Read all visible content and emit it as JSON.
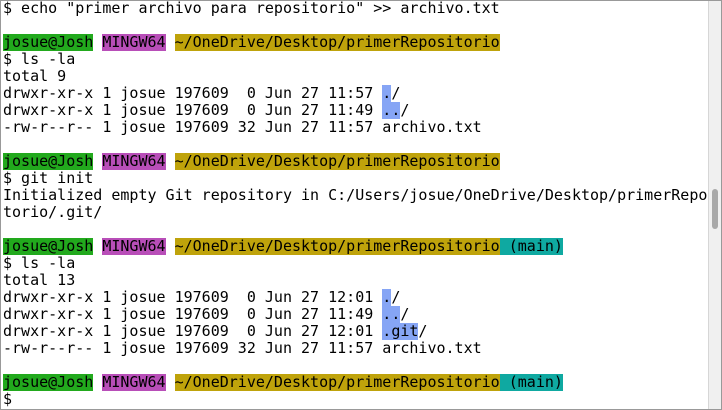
{
  "colors": {
    "user": "#22a91d",
    "system": "#b84eb8",
    "path": "#bfa30b",
    "branch": "#0fa9a1",
    "directory": "#86a5f5"
  },
  "lines": [
    {
      "segments": [
        {
          "text": "$ echo \"primer archivo para repositorio\" >> archivo.txt"
        }
      ]
    },
    {
      "segments": []
    },
    {
      "segments": [
        {
          "text": "josue@Josh",
          "hl": "user"
        },
        {
          "text": " "
        },
        {
          "text": "MINGW64",
          "hl": "system"
        },
        {
          "text": " "
        },
        {
          "text": "~/OneDrive/Desktop/primerRepositorio",
          "hl": "path"
        }
      ]
    },
    {
      "segments": [
        {
          "text": "$ ls -la"
        }
      ]
    },
    {
      "segments": [
        {
          "text": "total 9"
        }
      ]
    },
    {
      "segments": [
        {
          "text": "drwxr-xr-x 1 josue 197609  0 Jun 27 11:57 "
        },
        {
          "text": ".",
          "hl": "directory"
        },
        {
          "text": "/"
        }
      ]
    },
    {
      "segments": [
        {
          "text": "drwxr-xr-x 1 josue 197609  0 Jun 27 11:49 "
        },
        {
          "text": "..",
          "hl": "directory"
        },
        {
          "text": "/"
        }
      ]
    },
    {
      "segments": [
        {
          "text": "-rw-r--r-- 1 josue 197609 32 Jun 27 11:57 archivo.txt"
        }
      ]
    },
    {
      "segments": []
    },
    {
      "segments": [
        {
          "text": "josue@Josh",
          "hl": "user"
        },
        {
          "text": " "
        },
        {
          "text": "MINGW64",
          "hl": "system"
        },
        {
          "text": " "
        },
        {
          "text": "~/OneDrive/Desktop/primerRepositorio",
          "hl": "path"
        }
      ]
    },
    {
      "segments": [
        {
          "text": "$ git init"
        }
      ]
    },
    {
      "segments": [
        {
          "text": "Initialized empty Git repository in C:/Users/josue/OneDrive/Desktop/primerReposi"
        }
      ]
    },
    {
      "segments": [
        {
          "text": "torio/.git/"
        }
      ]
    },
    {
      "segments": []
    },
    {
      "segments": [
        {
          "text": "josue@Josh",
          "hl": "user"
        },
        {
          "text": " "
        },
        {
          "text": "MINGW64",
          "hl": "system"
        },
        {
          "text": " "
        },
        {
          "text": "~/OneDrive/Desktop/primerRepositorio",
          "hl": "path"
        },
        {
          "text": " (main)",
          "hl": "branch"
        }
      ]
    },
    {
      "segments": [
        {
          "text": "$ ls -la"
        }
      ]
    },
    {
      "segments": [
        {
          "text": "total 13"
        }
      ]
    },
    {
      "segments": [
        {
          "text": "drwxr-xr-x 1 josue 197609  0 Jun 27 12:01 "
        },
        {
          "text": ".",
          "hl": "directory"
        },
        {
          "text": "/"
        }
      ]
    },
    {
      "segments": [
        {
          "text": "drwxr-xr-x 1 josue 197609  0 Jun 27 11:49 "
        },
        {
          "text": "..",
          "hl": "directory"
        },
        {
          "text": "/"
        }
      ]
    },
    {
      "segments": [
        {
          "text": "drwxr-xr-x 1 josue 197609  0 Jun 27 12:01 "
        },
        {
          "text": ".git",
          "hl": "directory"
        },
        {
          "text": "/"
        }
      ]
    },
    {
      "segments": [
        {
          "text": "-rw-r--r-- 1 josue 197609 32 Jun 27 11:57 archivo.txt"
        }
      ]
    },
    {
      "segments": []
    },
    {
      "segments": [
        {
          "text": "josue@Josh",
          "hl": "user"
        },
        {
          "text": " "
        },
        {
          "text": "MINGW64",
          "hl": "system"
        },
        {
          "text": " "
        },
        {
          "text": "~/OneDrive/Desktop/primerRepositorio",
          "hl": "path"
        },
        {
          "text": " (main)",
          "hl": "branch"
        }
      ]
    },
    {
      "segments": [
        {
          "text": "$"
        }
      ]
    }
  ]
}
